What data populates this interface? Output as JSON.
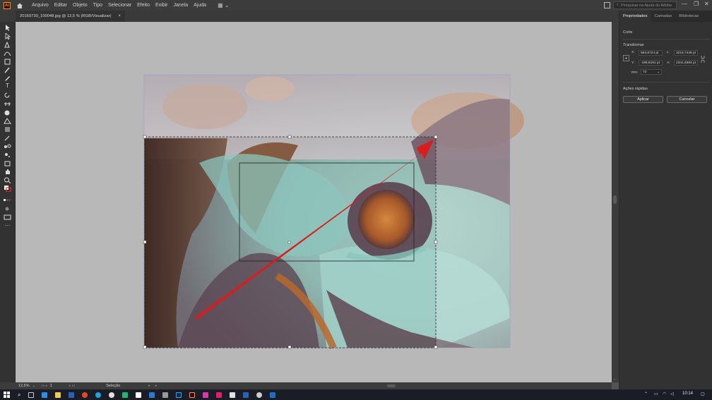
{
  "menubar": {
    "app_logo": "Ai",
    "items": [
      "Arquivo",
      "Editar",
      "Objeto",
      "Tipo",
      "Selecionar",
      "Efeito",
      "Exibir",
      "Janela",
      "Ajuda"
    ],
    "search_placeholder": "Pesquisar na Ajuda do Adobe",
    "window_controls": [
      "—",
      "❐",
      "✕"
    ]
  },
  "document_tab": {
    "title": "20160730_100048.jpg @ 12,5 % (RGB/Visualizar)",
    "close": "×"
  },
  "status_bar": {
    "zoom": "12,5%",
    "artboard": "1",
    "tool": "Seleção"
  },
  "panel": {
    "tabs": [
      "Propriedades",
      "Camadas",
      "Bibliotecas"
    ],
    "active_tab": "Propriedades",
    "section_title": "Corte",
    "transform_label": "Transformar",
    "fields": {
      "x_label": "X:",
      "x_value": "553,8724 pt",
      "l_label": "L:",
      "l_value": "3219,7446 pt",
      "y_label": "Y:",
      "y_value": "-199,8191 pt",
      "a_label": "A:",
      "a_value": "2341,6384 pt",
      "ppi_label": "PPI:",
      "ppi_value": "72"
    },
    "quick_actions_label": "Ações rápidas",
    "apply_button": "Aplicar",
    "cancel_button": "Cancelar"
  },
  "taskbar": {
    "time": "10:14"
  },
  "colors": {
    "accent": "#2d8ceb",
    "arrow": "#d91c1c",
    "canvas_bg": "#b8b8b8"
  }
}
